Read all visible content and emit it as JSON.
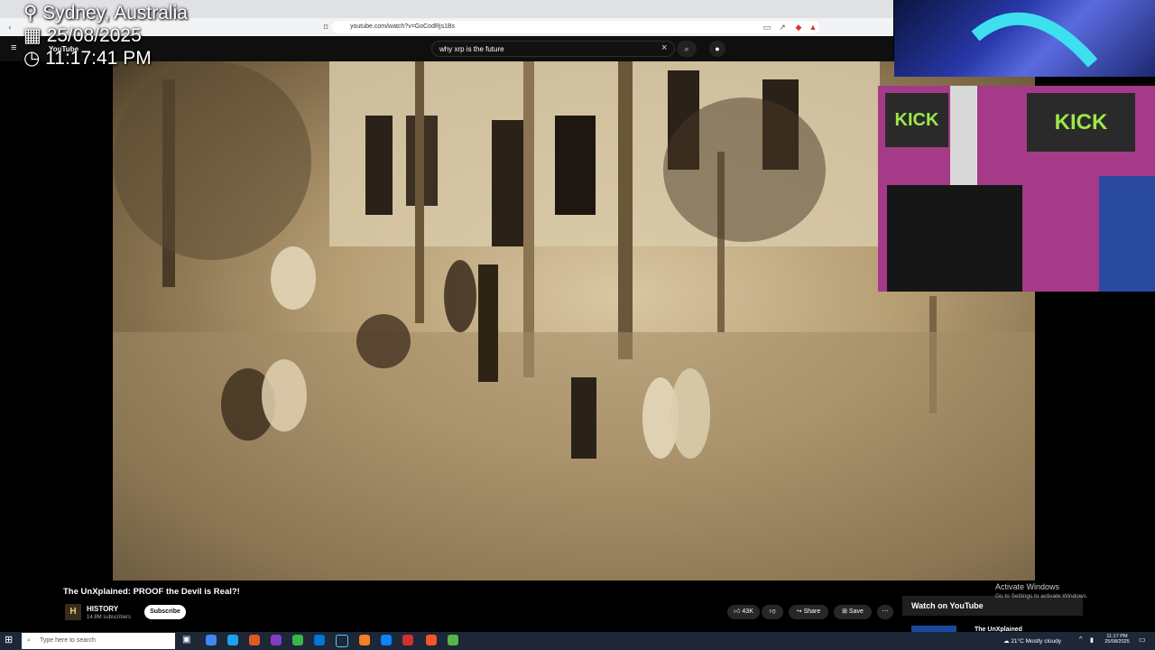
{
  "overlay": {
    "location": "Sydney, Australia",
    "date": "25/08/2025",
    "time": "11:17:41 PM",
    "location_icon": "pin-icon",
    "date_icon": "calendar-icon",
    "time_icon": "clock-icon"
  },
  "browser": {
    "url": "youtube.com/watch?v=GoCodRjs1Bs"
  },
  "youtube": {
    "logo_text": "YouTube",
    "search_value": "why xrp is the future"
  },
  "video": {
    "title": "The UnXplained: PROOF the Devil is Real?!",
    "channel": "HISTORY",
    "subscribers": "14.8M subscribers",
    "subscribe_label": "Subscribe",
    "likes": "43K",
    "share_label": "Share",
    "save_label": "Save"
  },
  "webcam": {
    "banner_left": "KICK",
    "banner_right": "KICK"
  },
  "sidebar": {
    "watch_on_youtube": "Watch on YouTube",
    "next_title": "The UnXplained"
  },
  "windows": {
    "activate_title": "Activate Windows",
    "activate_sub": "Go to Settings to activate Windows.",
    "taskbar_search": "Type here to search",
    "weather": "21°C  Mostly cloudy",
    "clock_time": "11:17 PM",
    "clock_date": "25/08/2025"
  },
  "colors": {
    "accent": "#ff0000",
    "yt_dark": "#0f0f0f",
    "sepia": "#b59d73"
  }
}
